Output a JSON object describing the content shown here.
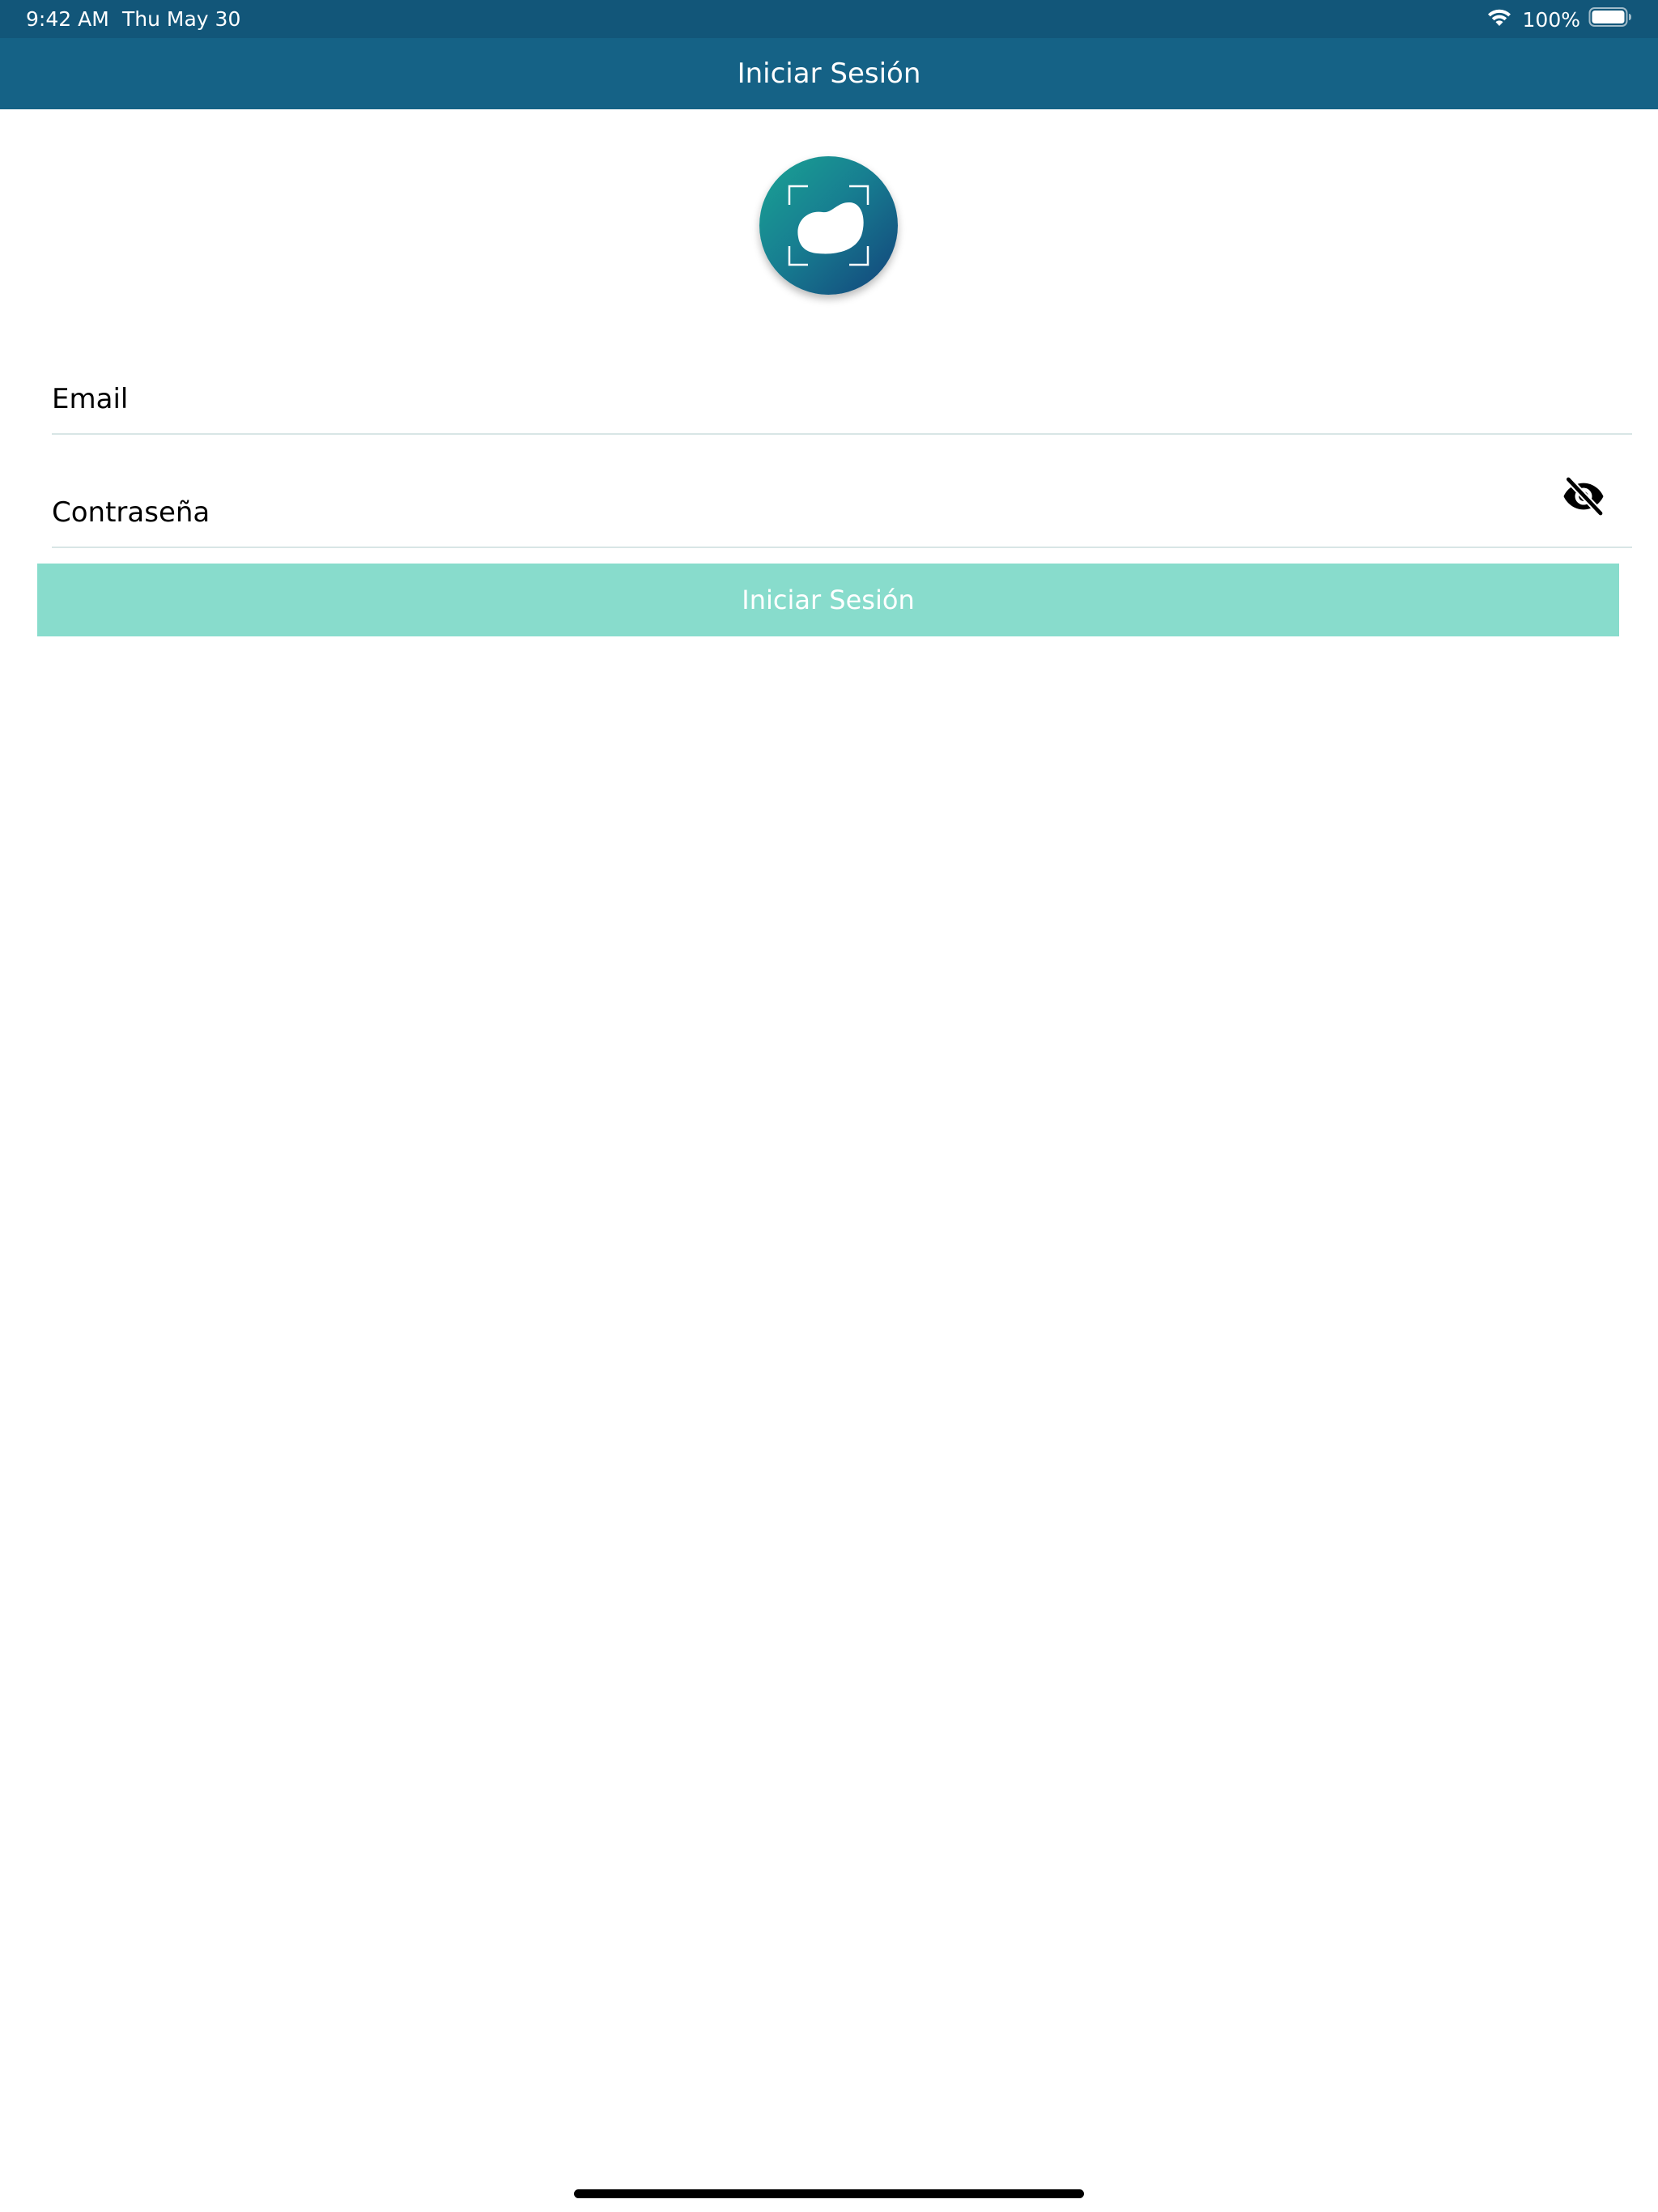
{
  "status_bar": {
    "time": "9:42 AM",
    "date": "Thu May 30",
    "battery_percent": "100%",
    "battery_level": 1.0,
    "icons": [
      "wifi-icon",
      "battery-icon"
    ]
  },
  "nav_bar": {
    "title": "Iniciar Sesión"
  },
  "logo": {
    "icon": "bean-scan-icon",
    "gradient": [
      "#1aa394",
      "#13437b"
    ]
  },
  "form": {
    "email": {
      "placeholder": "Email",
      "value": ""
    },
    "password": {
      "placeholder": "Contraseña",
      "value": "",
      "toggle_icon": "eye-slash-icon"
    },
    "submit_label": "Iniciar Sesión"
  },
  "colors": {
    "status_bar": "#125679",
    "nav_bar": "#156286",
    "button": "#88dccc",
    "divider": "#d8e6e6"
  }
}
